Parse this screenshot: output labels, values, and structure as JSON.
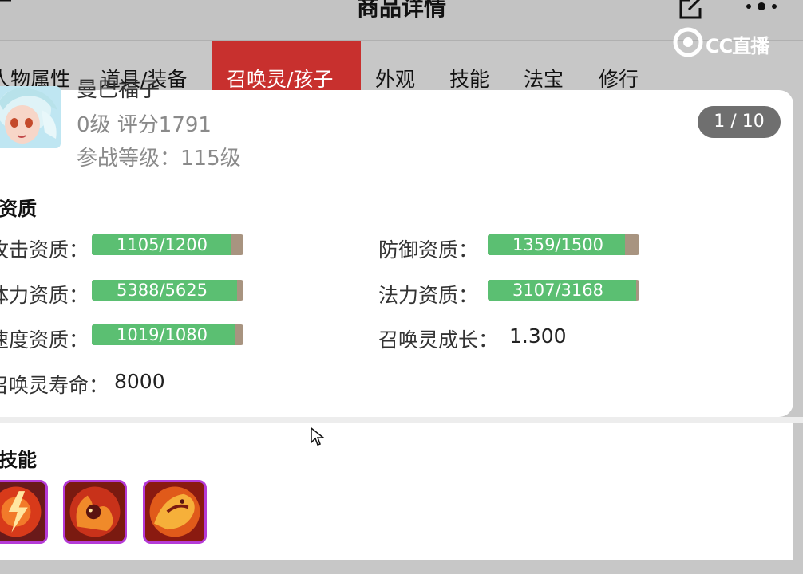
{
  "header": {
    "title": "商品详情"
  },
  "watermark": {
    "text": "CC直播"
  },
  "tabs": [
    {
      "label": "人物属性"
    },
    {
      "label": "道具/装备"
    },
    {
      "label": "召唤灵/孩子",
      "active": true
    },
    {
      "label": "外观"
    },
    {
      "label": "技能"
    },
    {
      "label": "法宝"
    },
    {
      "label": "修行"
    }
  ],
  "pet": {
    "name": "曼巴福子",
    "level_score": "0级 评分1791",
    "battle_level": "参战等级：115级"
  },
  "pager": "1 / 10",
  "aptitude": {
    "title": "资质",
    "attack": {
      "label": "攻击资质：",
      "value": "1105/1200",
      "fill": 0.92
    },
    "defense": {
      "label": "防御资质：",
      "value": "1359/1500",
      "fill": 0.906
    },
    "stamina": {
      "label": "体力资质：",
      "value": "5388/5625",
      "fill": 0.958
    },
    "magic": {
      "label": "法力资质：",
      "value": "3107/3168",
      "fill": 0.981
    },
    "speed": {
      "label": "速度资质：",
      "value": "1019/1080",
      "fill": 0.944
    },
    "growth": {
      "label": "召唤灵成长：",
      "value": "1.300"
    },
    "lifespan": {
      "label": "召唤灵寿命：",
      "value": "8000"
    }
  },
  "skills": {
    "title": "技能",
    "icons": [
      "lightning-skill-icon",
      "fire-beast-skill-icon",
      "fire-dragon-skill-icon"
    ]
  },
  "colors": {
    "active_tab": "#c8302e",
    "bar_fill": "#5bbf72",
    "bar_track": "#a89480",
    "skill_border": "#b53bd6"
  }
}
